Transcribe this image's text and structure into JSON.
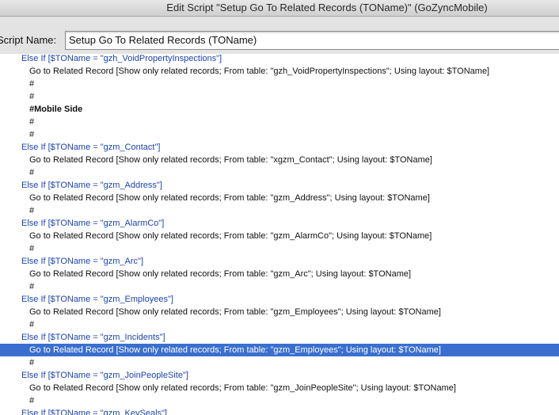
{
  "window": {
    "title": "Edit Script \"Setup Go To Related Records (TOName)\" (GoZyncMobile)"
  },
  "script_name": {
    "label": "Script Name:",
    "value": "Setup Go To Related Records (TOName)"
  },
  "steps": [
    {
      "text": "Else If [$TOName = \"gzh_VoidPropertyInspections\"]",
      "kind": "ctrl"
    },
    {
      "text": "Go to Related Record [Show only related records; From table: \"gzh_VoidPropertyInspections\"; Using layout: $TOName]",
      "kind": "step"
    },
    {
      "text": "#",
      "kind": "step"
    },
    {
      "text": "#",
      "kind": "step"
    },
    {
      "text": "#Mobile Side",
      "kind": "bold"
    },
    {
      "text": "#",
      "kind": "step"
    },
    {
      "text": "#",
      "kind": "step"
    },
    {
      "text": "Else If [$TOName = \"gzm_Contact\"]",
      "kind": "ctrl"
    },
    {
      "text": "Go to Related Record [Show only related records; From table: \"xgzm_Contact\"; Using layout: $TOName]",
      "kind": "step"
    },
    {
      "text": "#",
      "kind": "step"
    },
    {
      "text": "Else If [$TOName = \"gzm_Address\"]",
      "kind": "ctrl"
    },
    {
      "text": "Go to Related Record [Show only related records; From table: \"gzm_Address\"; Using layout: $TOName]",
      "kind": "step"
    },
    {
      "text": "#",
      "kind": "step"
    },
    {
      "text": "Else If [$TOName = \"gzm_AlarmCo\"]",
      "kind": "ctrl"
    },
    {
      "text": "Go to Related Record [Show only related records; From table: \"gzm_AlarmCo\"; Using layout: $TOName]",
      "kind": "step"
    },
    {
      "text": "#",
      "kind": "step"
    },
    {
      "text": "Else If [$TOName = \"gzm_Arc\"]",
      "kind": "ctrl"
    },
    {
      "text": "Go to Related Record [Show only related records; From table: \"gzm_Arc\"; Using layout: $TOName]",
      "kind": "step"
    },
    {
      "text": "#",
      "kind": "step"
    },
    {
      "text": "Else If [$TOName = \"gzm_Employees\"]",
      "kind": "ctrl"
    },
    {
      "text": "Go to Related Record [Show only related records; From table: \"gzm_Employees\"; Using layout: $TOName]",
      "kind": "step"
    },
    {
      "text": "#",
      "kind": "step"
    },
    {
      "text": "Else If [$TOName = \"gzm_Incidents\"]",
      "kind": "ctrl"
    },
    {
      "text": "Go to Related Record [Show only related records; From table: \"gzm_Employees\"; Using layout: $TOName]",
      "kind": "step",
      "selected": true
    },
    {
      "text": "#",
      "kind": "step"
    },
    {
      "text": "Else If [$TOName = \"gzm_JoinPeopleSite\"]",
      "kind": "ctrl"
    },
    {
      "text": "Go to Related Record [Show only related records; From table: \"gzm_JoinPeopleSite\"; Using layout: $TOName]",
      "kind": "step"
    },
    {
      "text": "#",
      "kind": "step"
    },
    {
      "text": "Else If [$TOName = \"gzm_KeySeals\"]",
      "kind": "ctrl"
    }
  ],
  "colors": {
    "control_text": "#1d44b0",
    "selection": "#3a6fcf"
  }
}
